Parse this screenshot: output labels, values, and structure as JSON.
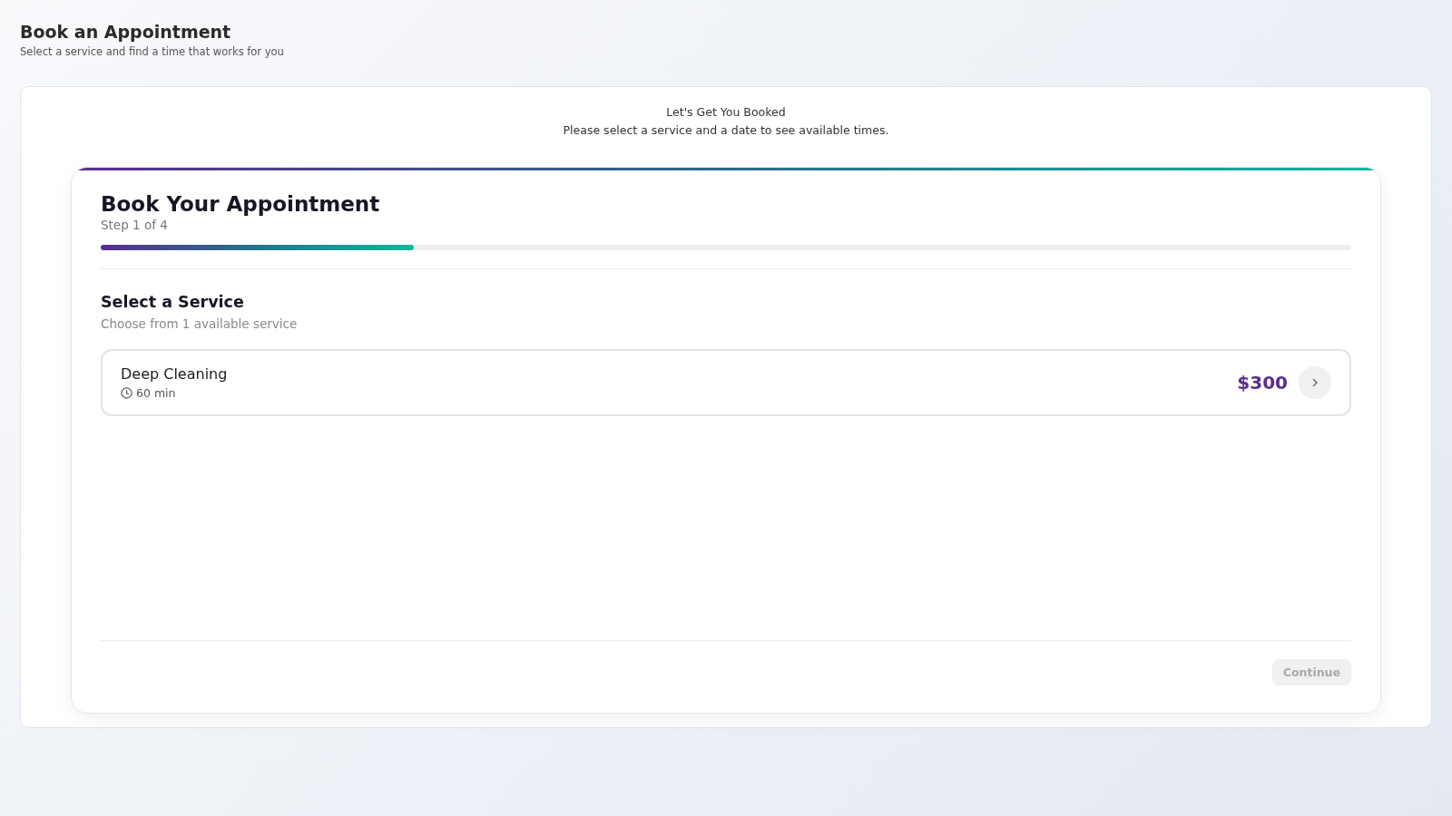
{
  "page": {
    "title": "Book an Appointment",
    "subtitle": "Select a service and find a time that works for you"
  },
  "notice": {
    "title": "Let's Get You Booked",
    "message": "Please select a service and a date to see available times."
  },
  "wizard": {
    "title": "Book Your Appointment",
    "step": "Step 1 of 4",
    "progress": {
      "level": 0.25
    },
    "section": {
      "title": "Select a Service",
      "subtitle": "Choose from 1 available service"
    },
    "services": [
      {
        "name": "Deep Cleaning",
        "duration": "60 min",
        "price": "$300",
        "selected": false
      }
    ],
    "continue_button": {
      "label": "Continue",
      "disabled": true
    }
  }
}
